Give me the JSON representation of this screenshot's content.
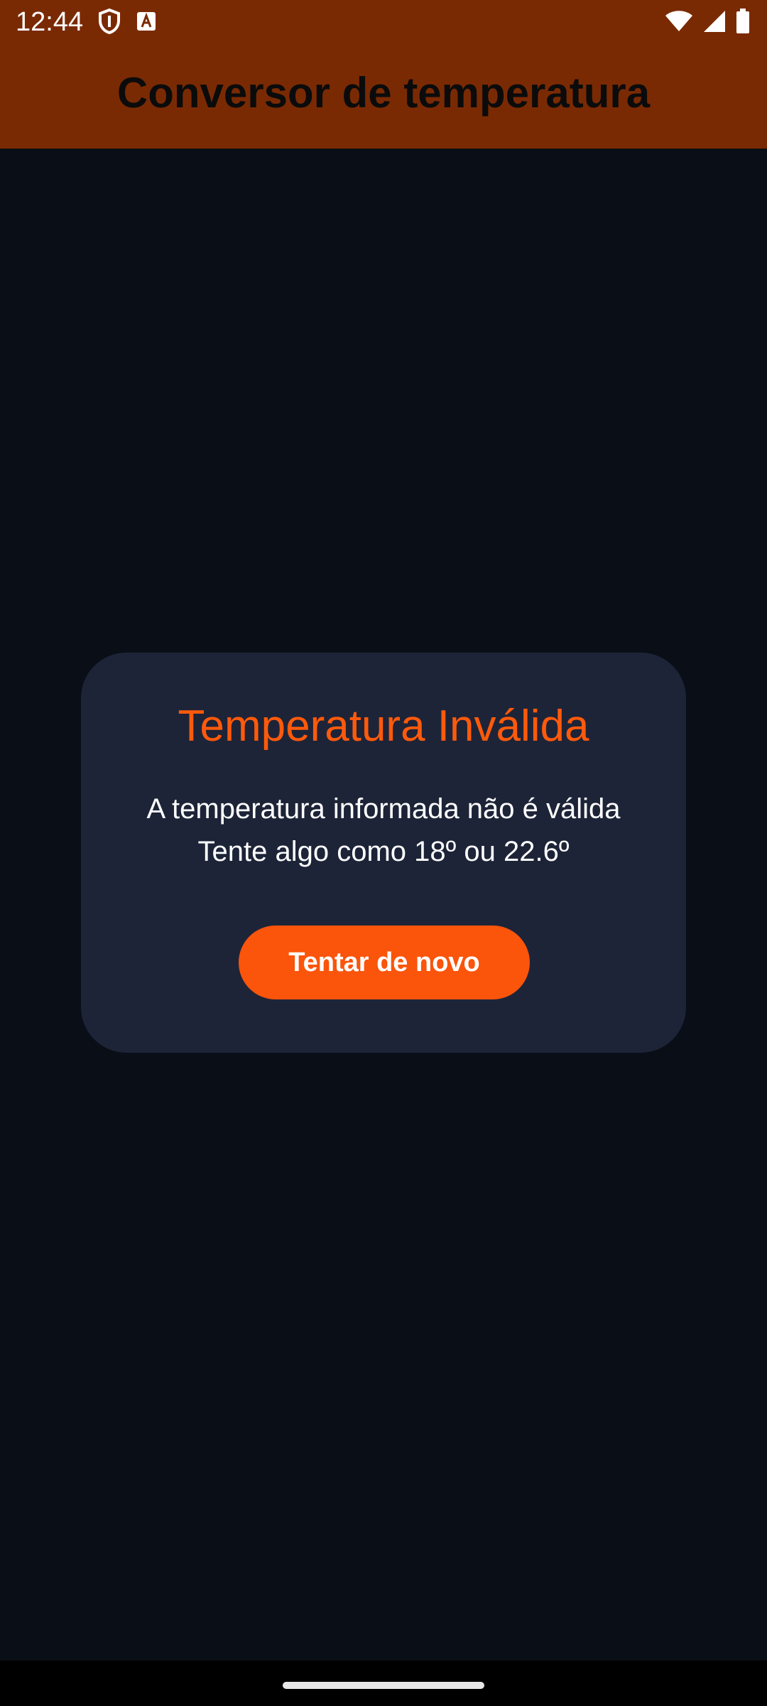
{
  "status_bar": {
    "time": "12:44",
    "left_icons": [
      "shield-icon",
      "font-a-icon"
    ],
    "right_icons": [
      "wifi-icon",
      "signal-icon",
      "battery-icon"
    ]
  },
  "app_bar": {
    "title": "Conversor de temperatura",
    "background_color": "#7a2a03"
  },
  "dialog": {
    "title": "Temperatura Inválida",
    "message_line1": "A temperatura informada não é válida",
    "message_line2": "Tente algo como 18º ou 22.6º",
    "button_label": "Tentar de novo",
    "accent_color": "#fb540b",
    "background_color": "#1d2438"
  },
  "colors": {
    "page_background": "#0a0e16"
  }
}
